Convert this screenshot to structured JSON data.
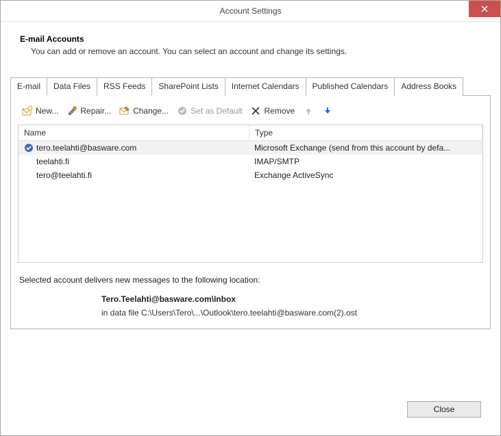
{
  "window": {
    "title": "Account Settings"
  },
  "header": {
    "heading": "E-mail Accounts",
    "description": "You can add or remove an account. You can select an account and change its settings."
  },
  "tabs": [
    {
      "id": "email",
      "label": "E-mail",
      "active": true
    },
    {
      "id": "data-files",
      "label": "Data Files",
      "active": false
    },
    {
      "id": "rss",
      "label": "RSS Feeds",
      "active": false
    },
    {
      "id": "sharepoint",
      "label": "SharePoint Lists",
      "active": false
    },
    {
      "id": "internet-cal",
      "label": "Internet Calendars",
      "active": false
    },
    {
      "id": "published-cal",
      "label": "Published Calendars",
      "active": false
    },
    {
      "id": "address-books",
      "label": "Address Books",
      "active": false
    }
  ],
  "toolbar": {
    "new": "New...",
    "repair": "Repair...",
    "change": "Change...",
    "set_default": "Set as Default",
    "remove": "Remove"
  },
  "columns": {
    "name": "Name",
    "type": "Type"
  },
  "accounts": [
    {
      "name": "tero.teelahti@basware.com",
      "type": "Microsoft Exchange (send from this account by defa...",
      "default": true,
      "selected": true
    },
    {
      "name": "teelahti.fi",
      "type": "IMAP/SMTP",
      "default": false,
      "selected": false
    },
    {
      "name": "tero@teelahti.fi",
      "type": "Exchange ActiveSync",
      "default": false,
      "selected": false
    }
  ],
  "delivery": {
    "intro": "Selected account delivers new messages to the following location:",
    "location": "Tero.Teelahti@basware.com\\Inbox",
    "path": "in data file C:\\Users\\Tero\\...\\Outlook\\tero.teelahti@basware.com(2).ost"
  },
  "buttons": {
    "close": "Close"
  }
}
